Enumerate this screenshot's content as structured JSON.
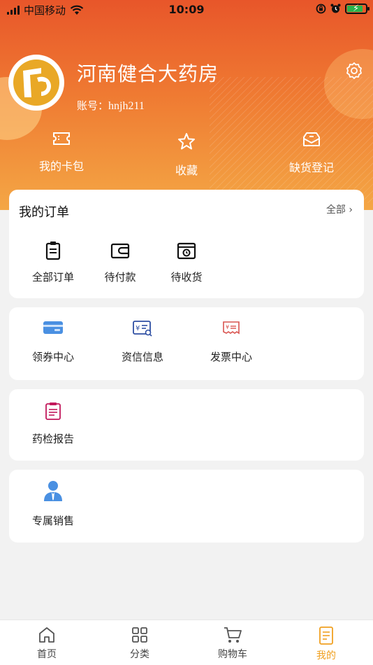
{
  "status_bar": {
    "carrier": "中国移动",
    "time": "10:09"
  },
  "profile": {
    "store_name": "河南健合大药房",
    "account_label": "账号：",
    "account_value": "hnjh211"
  },
  "quick_actions": [
    {
      "label": "我的卡包",
      "icon": "ticket-icon"
    },
    {
      "label": "收藏",
      "icon": "star-icon"
    },
    {
      "label": "缺货登记",
      "icon": "inbox-icon"
    }
  ],
  "orders": {
    "title": "我的订单",
    "all_label": "全部",
    "items": [
      {
        "label": "全部订单",
        "icon": "clipboard-icon"
      },
      {
        "label": "待付款",
        "icon": "wallet-icon"
      },
      {
        "label": "待收货",
        "icon": "delivery-box-icon"
      }
    ]
  },
  "services": [
    {
      "label": "领券中心",
      "icon": "coupon-card-icon"
    },
    {
      "label": "资信信息",
      "icon": "credit-info-icon"
    },
    {
      "label": "发票中心",
      "icon": "invoice-icon"
    }
  ],
  "reports": {
    "label": "药检报告",
    "icon": "report-icon"
  },
  "sales": {
    "label": "专属销售",
    "icon": "salesperson-icon"
  },
  "tabbar": [
    {
      "label": "首页",
      "icon": "home-icon"
    },
    {
      "label": "分类",
      "icon": "category-grid-icon"
    },
    {
      "label": "购物车",
      "icon": "cart-icon"
    },
    {
      "label": "我的",
      "icon": "profile-doc-icon",
      "active": true
    }
  ],
  "colors": {
    "accent": "#f0a020",
    "header_start": "#e8562a",
    "header_end": "#f4a745"
  }
}
